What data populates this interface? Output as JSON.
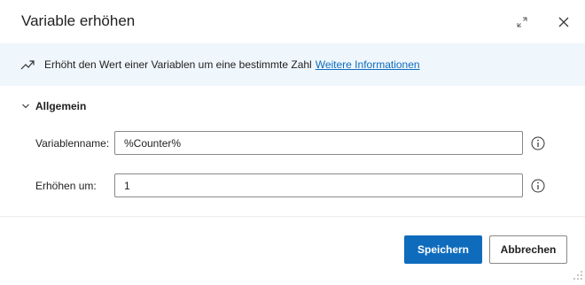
{
  "dialog": {
    "title": "Variable erhöhen"
  },
  "banner": {
    "icon": "trending-up-icon",
    "description": "Erhöht den Wert einer Variablen um eine bestimmte Zahl",
    "link": "Weitere Informationen"
  },
  "section": {
    "label": "Allgemein",
    "expanded": true
  },
  "fields": [
    {
      "label": "Variablenname:",
      "value": "%Counter%"
    },
    {
      "label": "Erhöhen um:",
      "value": "1"
    }
  ],
  "buttons": {
    "save": "Speichern",
    "cancel": "Abbrechen"
  },
  "colors": {
    "accent": "#0f6cbd",
    "banner_background": "#eff6fc"
  }
}
